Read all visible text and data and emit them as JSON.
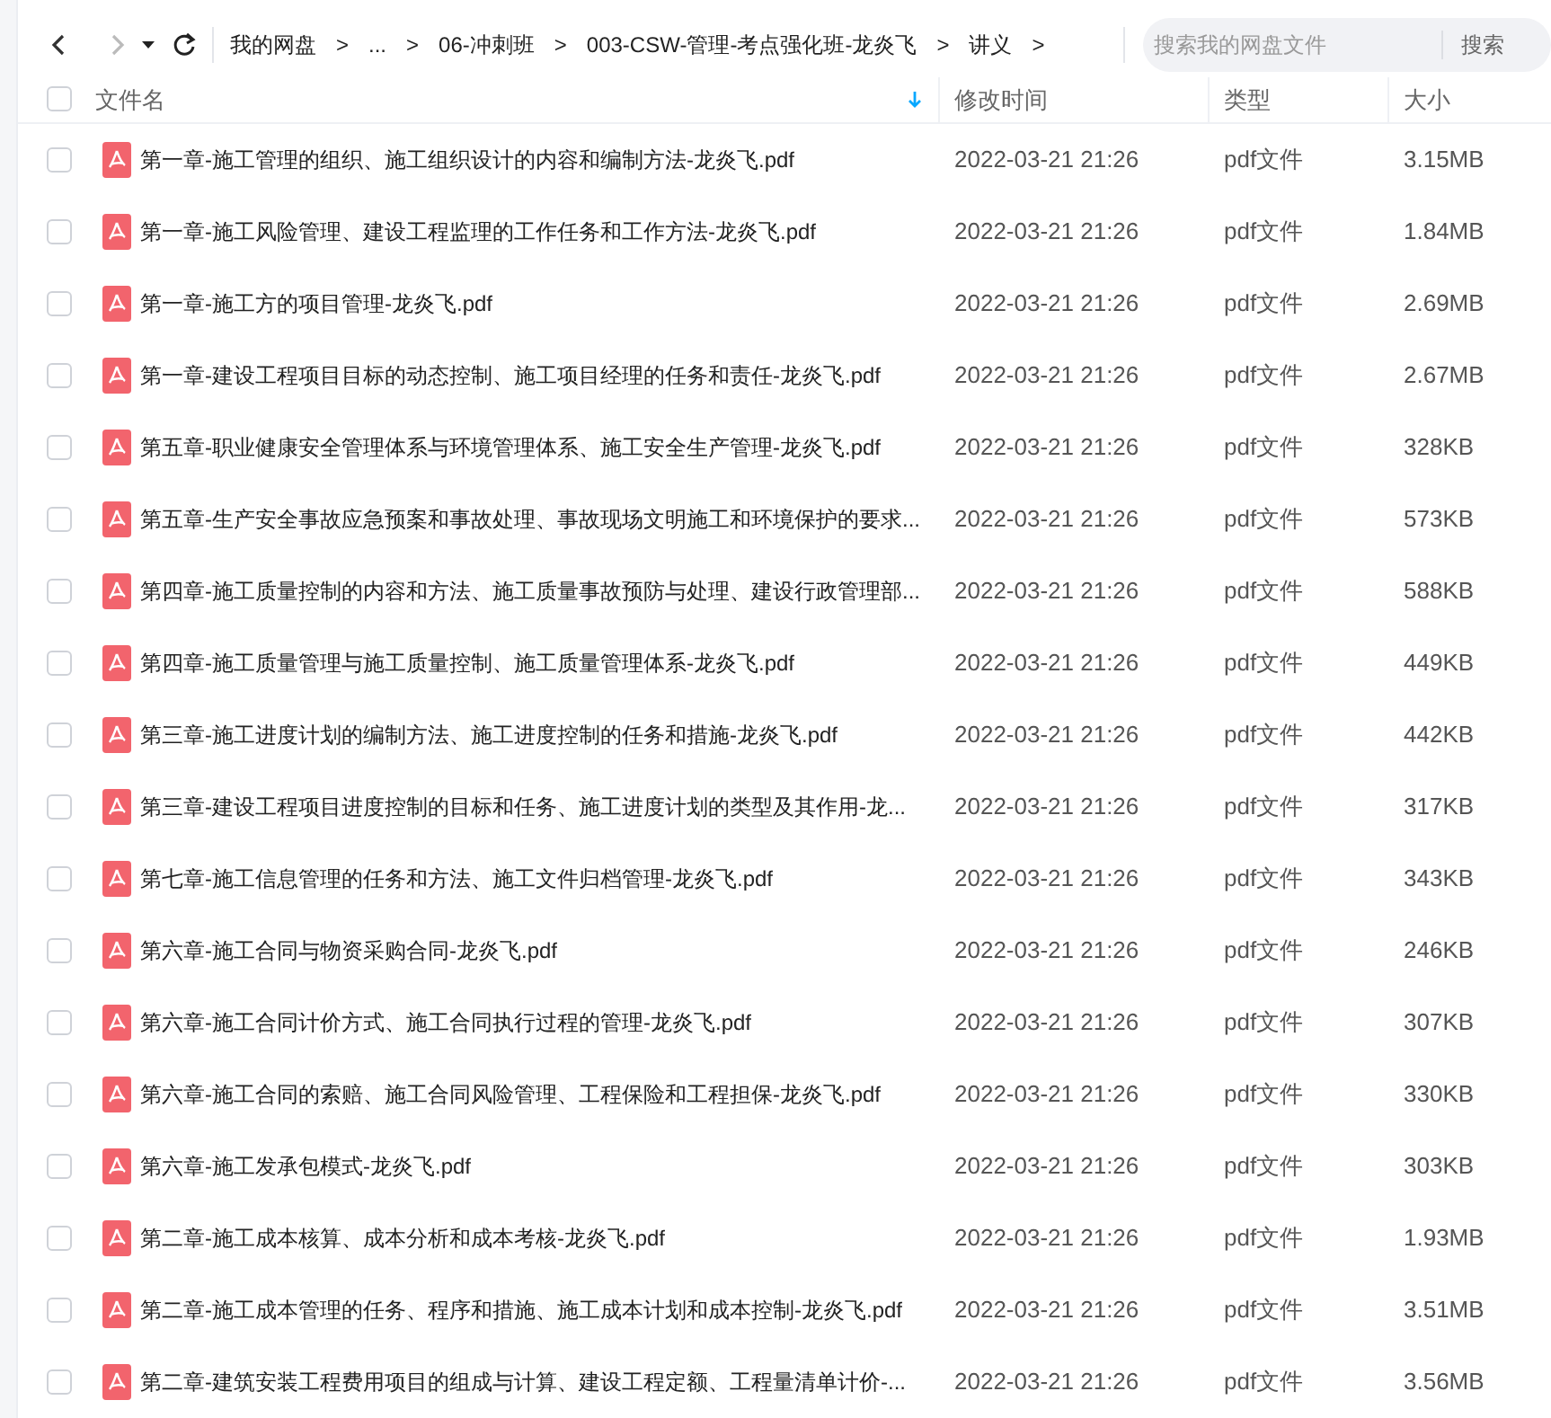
{
  "toolbar": {
    "back": {
      "disabled": false
    },
    "forward": {
      "disabled": true
    },
    "breadcrumb": [
      {
        "label": "我的网盘"
      },
      {
        "label": "..."
      },
      {
        "label": "06-冲刺班"
      },
      {
        "label": "003-CSW-管理-考点强化班-龙炎飞"
      },
      {
        "label": "讲义"
      }
    ],
    "breadcrumb_separator": ">",
    "search": {
      "placeholder": "搜索我的网盘文件",
      "button": "搜索"
    }
  },
  "table": {
    "select_all": {
      "checked": false
    },
    "columns": [
      {
        "label": "文件名",
        "sorted": true
      },
      {
        "label": "修改时间",
        "sorted": false
      },
      {
        "label": "类型",
        "sorted": false
      },
      {
        "label": "大小",
        "sorted": false
      }
    ],
    "rows": [
      {
        "name": "第一章-施工管理的组织、施工组织设计的内容和编制方法-龙炎飞.pdf",
        "modified": "2022-03-21 21:26",
        "type": "pdf文件",
        "size": "3.15MB",
        "checked": false
      },
      {
        "name": "第一章-施工风险管理、建设工程监理的工作任务和工作方法-龙炎飞.pdf",
        "modified": "2022-03-21 21:26",
        "type": "pdf文件",
        "size": "1.84MB",
        "checked": false
      },
      {
        "name": "第一章-施工方的项目管理-龙炎飞.pdf",
        "modified": "2022-03-21 21:26",
        "type": "pdf文件",
        "size": "2.69MB",
        "checked": false
      },
      {
        "name": "第一章-建设工程项目目标的动态控制、施工项目经理的任务和责任-龙炎飞.pdf",
        "modified": "2022-03-21 21:26",
        "type": "pdf文件",
        "size": "2.67MB",
        "checked": false
      },
      {
        "name": "第五章-职业健康安全管理体系与环境管理体系、施工安全生产管理-龙炎飞.pdf",
        "modified": "2022-03-21 21:26",
        "type": "pdf文件",
        "size": "328KB",
        "checked": false
      },
      {
        "name": "第五章-生产安全事故应急预案和事故处理、事故现场文明施工和环境保护的要求...",
        "modified": "2022-03-21 21:26",
        "type": "pdf文件",
        "size": "573KB",
        "checked": false
      },
      {
        "name": "第四章-施工质量控制的内容和方法、施工质量事故预防与处理、建设行政管理部...",
        "modified": "2022-03-21 21:26",
        "type": "pdf文件",
        "size": "588KB",
        "checked": false
      },
      {
        "name": "第四章-施工质量管理与施工质量控制、施工质量管理体系-龙炎飞.pdf",
        "modified": "2022-03-21 21:26",
        "type": "pdf文件",
        "size": "449KB",
        "checked": false
      },
      {
        "name": "第三章-施工进度计划的编制方法、施工进度控制的任务和措施-龙炎飞.pdf",
        "modified": "2022-03-21 21:26",
        "type": "pdf文件",
        "size": "442KB",
        "checked": false
      },
      {
        "name": "第三章-建设工程项目进度控制的目标和任务、施工进度计划的类型及其作用-龙...",
        "modified": "2022-03-21 21:26",
        "type": "pdf文件",
        "size": "317KB",
        "checked": false
      },
      {
        "name": "第七章-施工信息管理的任务和方法、施工文件归档管理-龙炎飞.pdf",
        "modified": "2022-03-21 21:26",
        "type": "pdf文件",
        "size": "343KB",
        "checked": false
      },
      {
        "name": "第六章-施工合同与物资采购合同-龙炎飞.pdf",
        "modified": "2022-03-21 21:26",
        "type": "pdf文件",
        "size": "246KB",
        "checked": false
      },
      {
        "name": "第六章-施工合同计价方式、施工合同执行过程的管理-龙炎飞.pdf",
        "modified": "2022-03-21 21:26",
        "type": "pdf文件",
        "size": "307KB",
        "checked": false
      },
      {
        "name": "第六章-施工合同的索赔、施工合同风险管理、工程保险和工程担保-龙炎飞.pdf",
        "modified": "2022-03-21 21:26",
        "type": "pdf文件",
        "size": "330KB",
        "checked": false
      },
      {
        "name": "第六章-施工发承包模式-龙炎飞.pdf",
        "modified": "2022-03-21 21:26",
        "type": "pdf文件",
        "size": "303KB",
        "checked": false
      },
      {
        "name": "第二章-施工成本核算、成本分析和成本考核-龙炎飞.pdf",
        "modified": "2022-03-21 21:26",
        "type": "pdf文件",
        "size": "1.93MB",
        "checked": false
      },
      {
        "name": "第二章-施工成本管理的任务、程序和措施、施工成本计划和成本控制-龙炎飞.pdf",
        "modified": "2022-03-21 21:26",
        "type": "pdf文件",
        "size": "3.51MB",
        "checked": false
      },
      {
        "name": "第二章-建筑安装工程费用项目的组成与计算、建设工程定额、工程量清单计价-...",
        "modified": "2022-03-21 21:26",
        "type": "pdf文件",
        "size": "3.56MB",
        "checked": false
      }
    ]
  }
}
